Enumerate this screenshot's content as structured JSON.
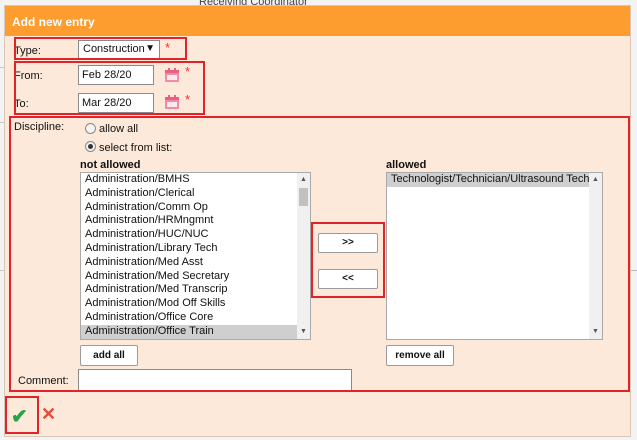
{
  "background": {
    "heading": "Receiving Coordinator"
  },
  "dialog": {
    "title": "Add new entry",
    "type": {
      "label": "Type:",
      "value": "Construction",
      "required_mark": "*"
    },
    "from": {
      "label": "From:",
      "value": "Feb 28/20",
      "required_mark": "*"
    },
    "to": {
      "label": "To:",
      "value": "Mar 28/20",
      "required_mark": "*"
    },
    "discipline": {
      "label": "Discipline:",
      "option_all": "allow all",
      "option_select": "select from list:",
      "selected_option": "select from list:",
      "not_allowed": {
        "header": "not allowed",
        "items": [
          "Administration/BMHS",
          "Administration/Clerical",
          "Administration/Comm Op",
          "Administration/HRMngmnt",
          "Administration/HUC/NUC",
          "Administration/Library Tech",
          "Administration/Med Asst",
          "Administration/Med Secretary",
          "Administration/Med Transcrip",
          "Administration/Mod Off Skills",
          "Administration/Office Core",
          "Administration/Office Train"
        ],
        "selected": "Administration/Office Train"
      },
      "allowed": {
        "header": "allowed",
        "items": [
          "Technologist/Technician/Ultrasound Tech"
        ],
        "selected": "Technologist/Technician/Ultrasound Tech"
      },
      "move_right": ">>",
      "move_left": "<<",
      "add_all": "add all",
      "remove_all": "remove all"
    },
    "comment": {
      "label": "Comment:",
      "value": ""
    },
    "save_icon": "checkmark-icon",
    "cancel_icon": "close-icon"
  },
  "colors": {
    "titlebar": "#fd9c2f",
    "dialog_bg": "#fde9d9",
    "required": "#e33333",
    "highlight_box": "#e0242a",
    "save": "#2aa24a",
    "cancel": "#e64a3b"
  }
}
